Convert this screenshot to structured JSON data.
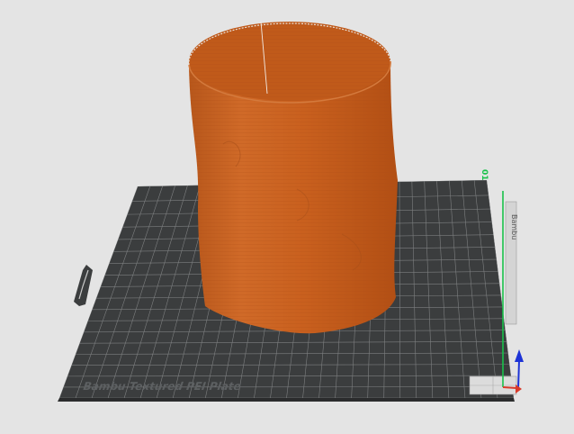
{
  "scene": {
    "plate_label": "Bambu Textured PEI Plate",
    "plate_number": "01",
    "background_color": "#e4e4e4",
    "plate_color": "#3b3d3e",
    "grid_color": "#8a8c8d",
    "model_color": "#c9601e",
    "model_inner_color": "#c05a1a",
    "axis_colors": {
      "x": "#d93a2a",
      "y": "#19c24a",
      "z": "#1d33d6"
    }
  }
}
